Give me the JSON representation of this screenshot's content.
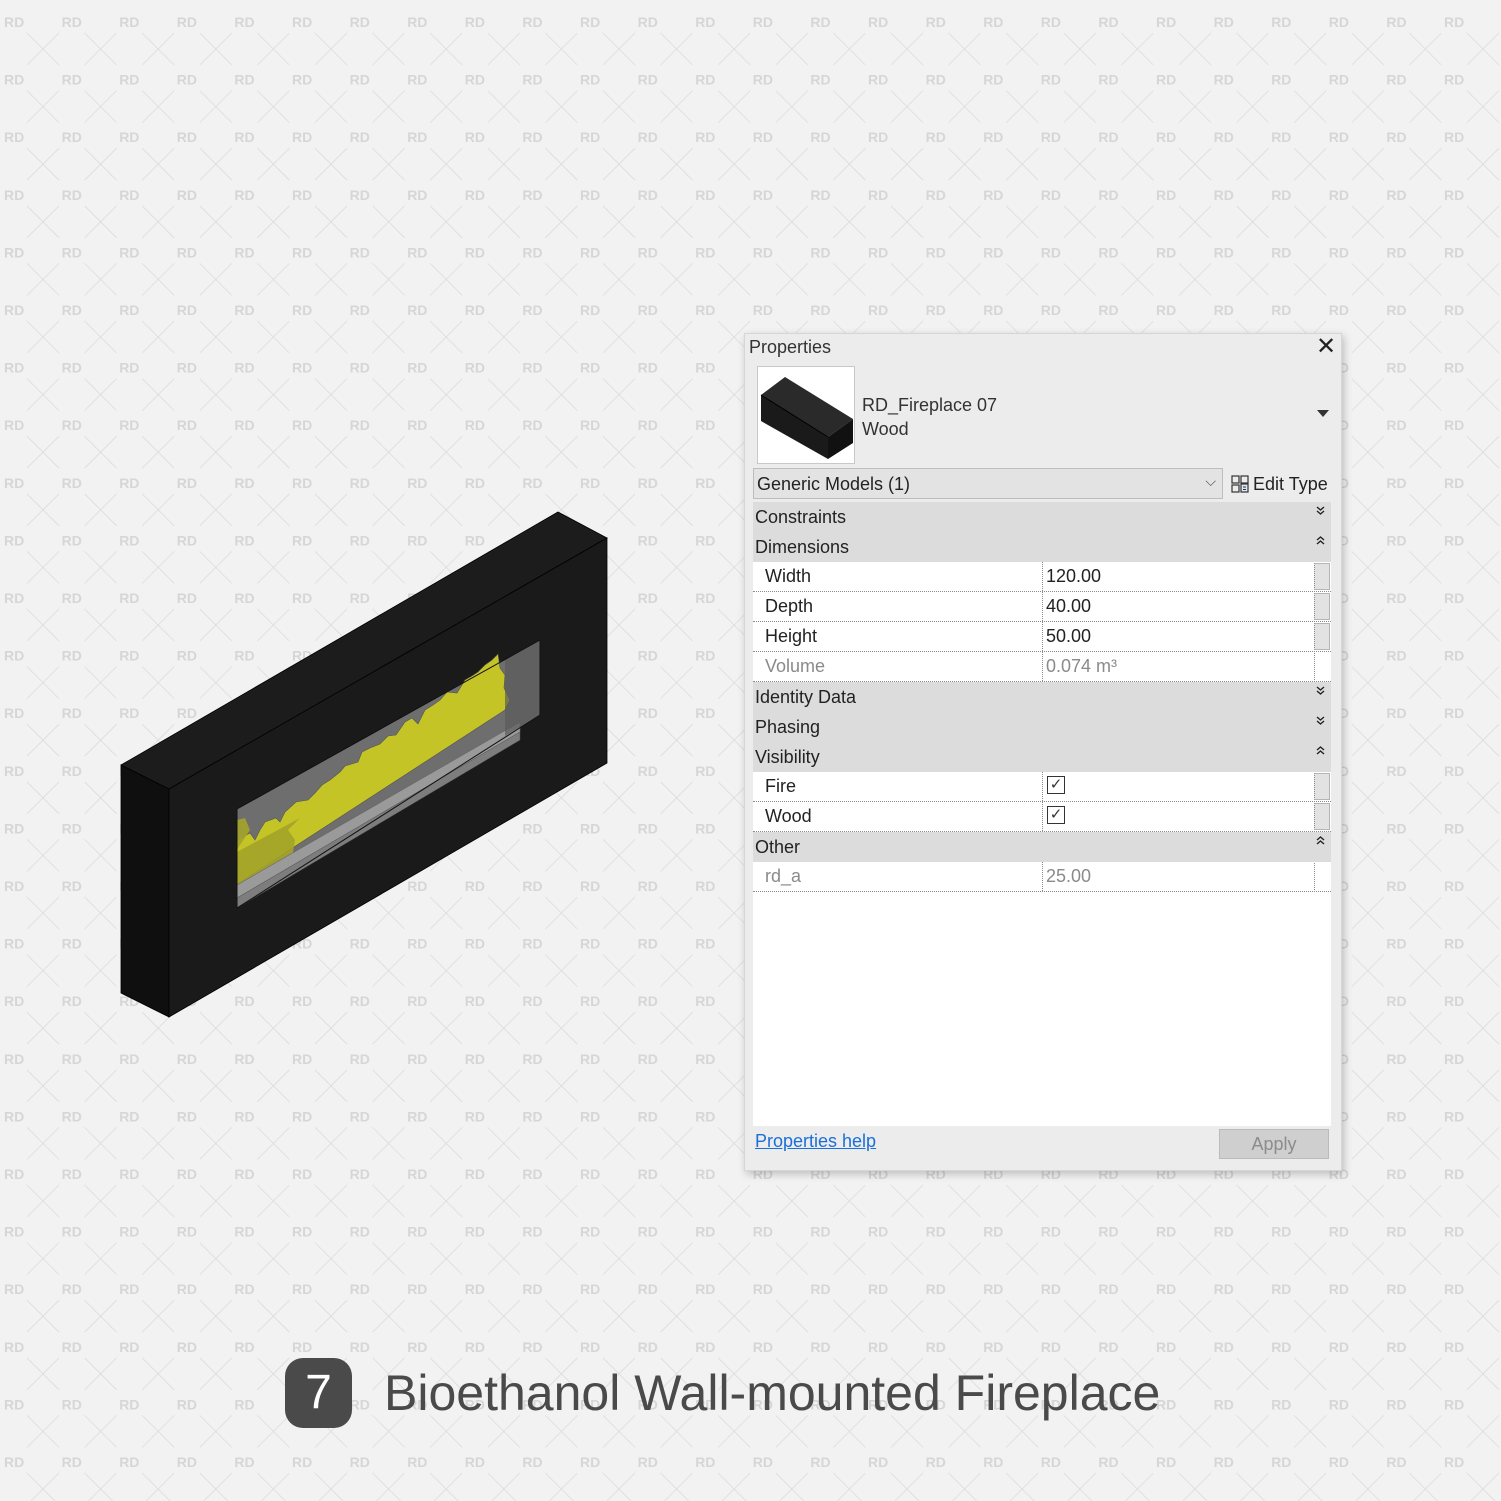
{
  "watermark": {
    "text": "RD",
    "text_color": "#d6d6d6",
    "line_color": "#dcdcdc"
  },
  "illustration": {
    "name": "Bioethanol wall-mounted fireplace 3D view",
    "colors": {
      "frame": "#1a1a1a",
      "frame_side": "#0e0e0e",
      "flame": "#c8c82a",
      "flame_dark": "#a5a52a",
      "glass": "#6a6a6a",
      "burner": "#8e8e8e"
    }
  },
  "panel": {
    "title": "Properties",
    "close_icon": "close-icon",
    "type_selector": {
      "family": "RD_Fireplace 07",
      "type": "Wood",
      "thumbnail_icon": "box-preview-icon",
      "dropdown_icon": "caret-down-icon"
    },
    "category_filter": {
      "value": "Generic Models (1)",
      "chevron_icon": "chevron-down-icon"
    },
    "edit_type": {
      "label": "Edit Type",
      "icon": "edit-type-icon"
    },
    "sections": [
      {
        "label": "Constraints",
        "expanded": false,
        "toggle": "⌄⌄",
        "rows": []
      },
      {
        "label": "Dimensions",
        "expanded": true,
        "toggle": "⌃⌃",
        "rows": [
          {
            "name": "Width",
            "value": "120.00",
            "readonly": false
          },
          {
            "name": "Depth",
            "value": "40.00",
            "readonly": false
          },
          {
            "name": "Height",
            "value": "50.00",
            "readonly": false
          },
          {
            "name": "Volume",
            "value": "0.074 m³",
            "readonly": true
          }
        ]
      },
      {
        "label": "Identity Data",
        "expanded": false,
        "toggle": "⌄⌄",
        "rows": []
      },
      {
        "label": "Phasing",
        "expanded": false,
        "toggle": "⌄⌄",
        "rows": []
      },
      {
        "label": "Visibility",
        "expanded": true,
        "toggle": "⌃⌃",
        "rows": [
          {
            "name": "Fire",
            "checked": true
          },
          {
            "name": "Wood",
            "checked": true
          }
        ]
      },
      {
        "label": "Other",
        "expanded": true,
        "toggle": "⌃⌃",
        "rows": [
          {
            "name": "rd_a",
            "value": "25.00",
            "readonly": true
          }
        ]
      }
    ],
    "help_link": "Properties help",
    "apply_label": "Apply"
  },
  "caption": {
    "number": "7",
    "title": "Bioethanol Wall-mounted Fireplace"
  }
}
